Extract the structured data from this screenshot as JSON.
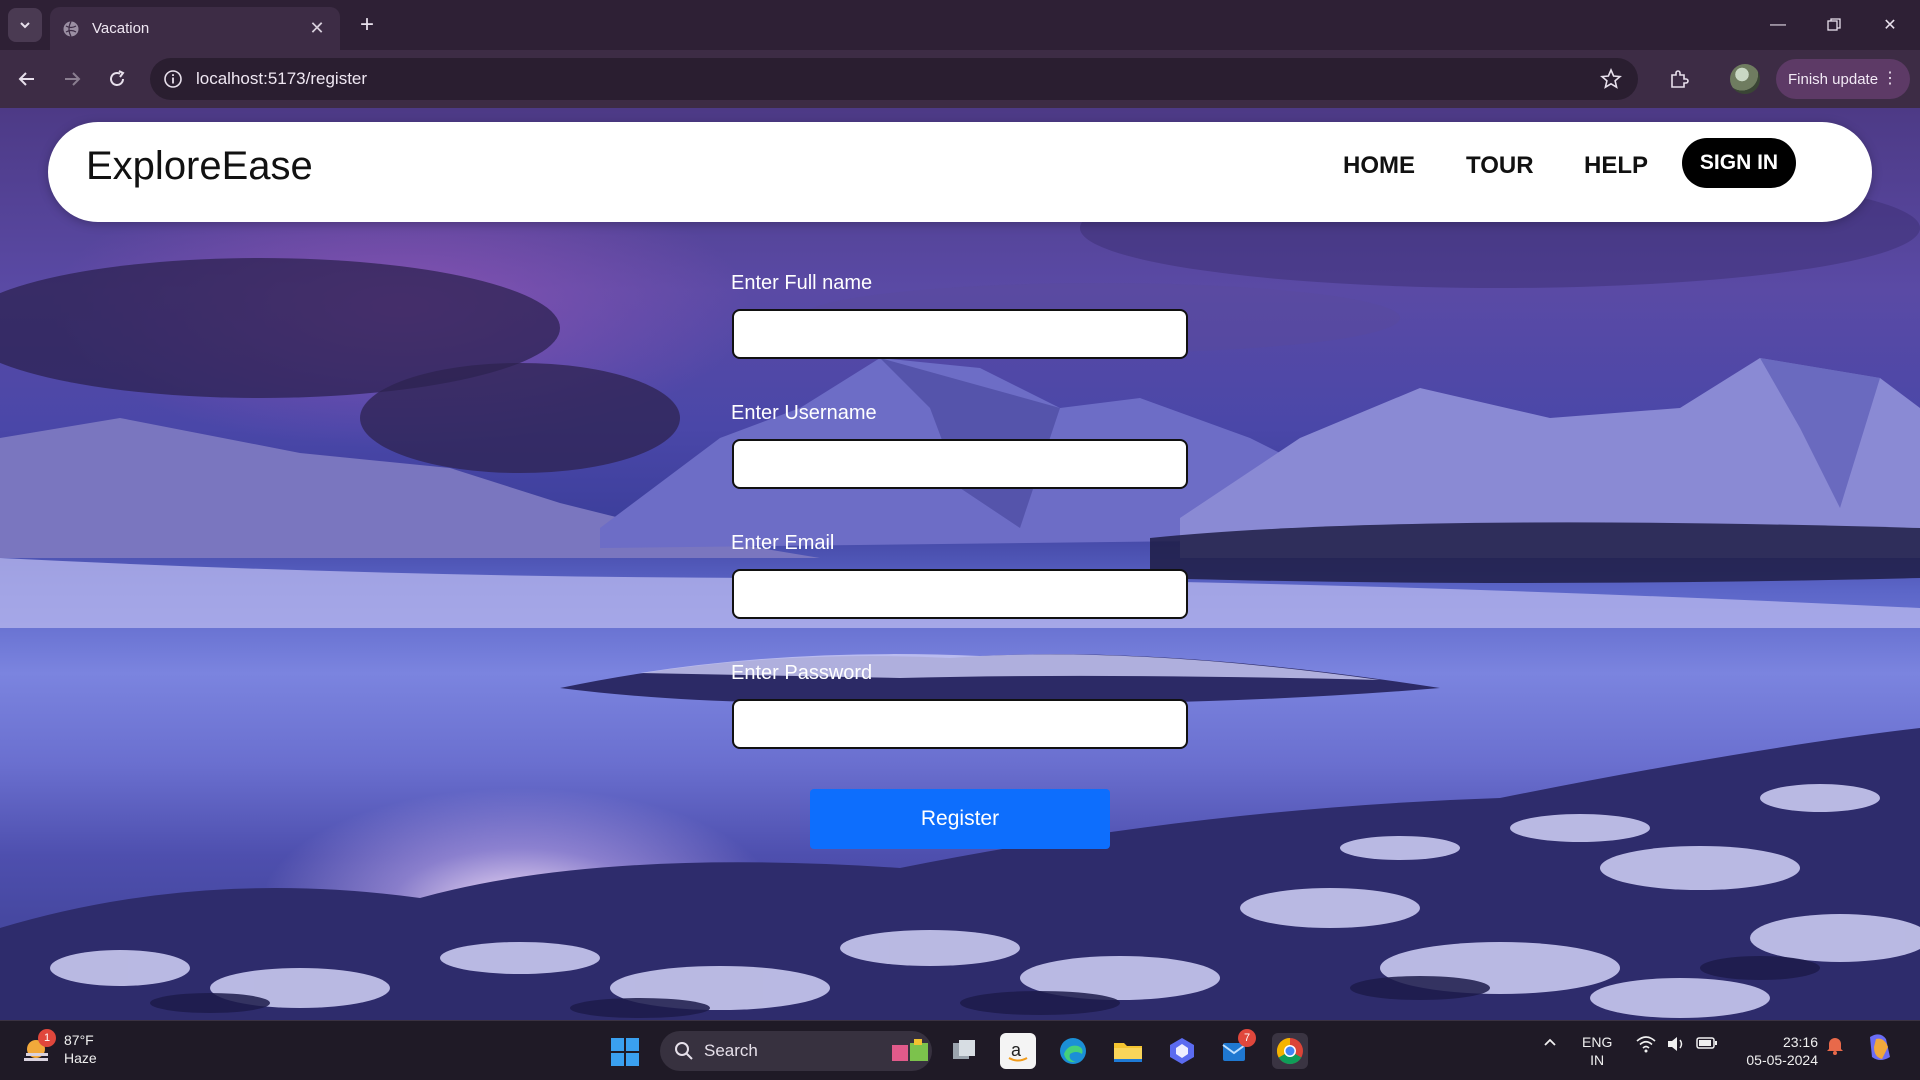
{
  "browser": {
    "tab_title": "Vacation",
    "url": "localhost:5173/register",
    "finish_update_label": "Finish update"
  },
  "site": {
    "brand": "ExploreEase",
    "nav": {
      "home": "HOME",
      "tour": "TOUR",
      "help": "HELP",
      "sign_in": "SIGN IN"
    }
  },
  "form": {
    "full_name_label": "Enter Full name",
    "full_name_value": "",
    "username_label": "Enter Username",
    "username_value": "",
    "email_label": "Enter Email",
    "email_value": "",
    "password_label": "Enter Password",
    "password_value": "",
    "register_label": "Register"
  },
  "taskbar": {
    "weather_temp": "87°F",
    "weather_desc": "Haze",
    "weather_badge": "1",
    "search_label": "Search",
    "mail_badge": "7",
    "lang_line1": "ENG",
    "lang_line2": "IN",
    "time": "23:16",
    "date": "05-05-2024"
  },
  "colors": {
    "register_button": "#0d6efd",
    "sign_in_button": "#000000",
    "browser_frame": "#3d2c45"
  }
}
